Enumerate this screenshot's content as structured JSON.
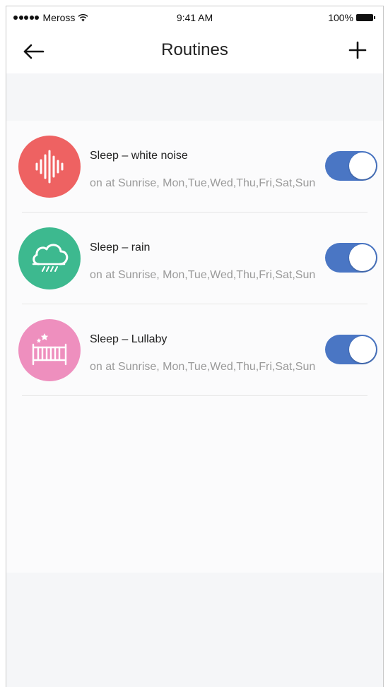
{
  "status_bar": {
    "carrier": "Meross",
    "time": "9:41 AM",
    "battery": "100%",
    "icons": [
      "signal-dots-icon",
      "wifi-icon",
      "battery-icon"
    ]
  },
  "nav": {
    "title": "Routines",
    "back_icon": "arrow-left-icon",
    "add_icon": "plus-icon"
  },
  "colors": {
    "toggle_on": "#4a76c4",
    "white_noise": "#ee6262",
    "rain": "#3db98f",
    "lullaby": "#ee8fbe"
  },
  "routines": [
    {
      "title": "Sleep – white noise",
      "schedule": "on at Sunrise, Mon,Tue,Wed,Thu,Fri,Sat,Sun",
      "icon": "sound-wave-icon",
      "enabled": true
    },
    {
      "title": "Sleep – rain",
      "schedule": "on at Sunrise, Mon,Tue,Wed,Thu,Fri,Sat,Sun",
      "icon": "rain-cloud-icon",
      "enabled": true
    },
    {
      "title": "Sleep – Lullaby",
      "schedule": "on at Sunrise, Mon,Tue,Wed,Thu,Fri,Sat,Sun",
      "icon": "crib-icon",
      "enabled": true
    }
  ]
}
